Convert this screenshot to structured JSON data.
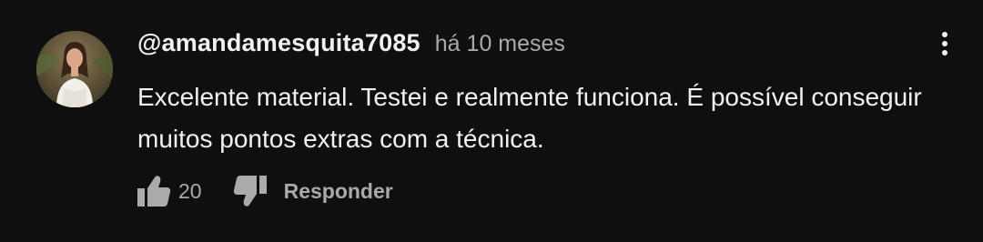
{
  "comment": {
    "author": "@amandamesquita7085",
    "time": "há 10 meses",
    "text": "Excelente material. Testei e realmente funciona. É possível conseguir muitos pontos extras com a técnica.",
    "likes": "20",
    "reply_label": "Responder"
  },
  "icons": {
    "avatar": "avatar-photo",
    "like": "thumbs-up-icon",
    "dislike": "thumbs-down-icon",
    "menu": "vertical-dots-icon"
  },
  "colors": {
    "background": "#0f0f0f",
    "primary_text": "#f1f1f1",
    "secondary_text": "#aaaaaa"
  }
}
